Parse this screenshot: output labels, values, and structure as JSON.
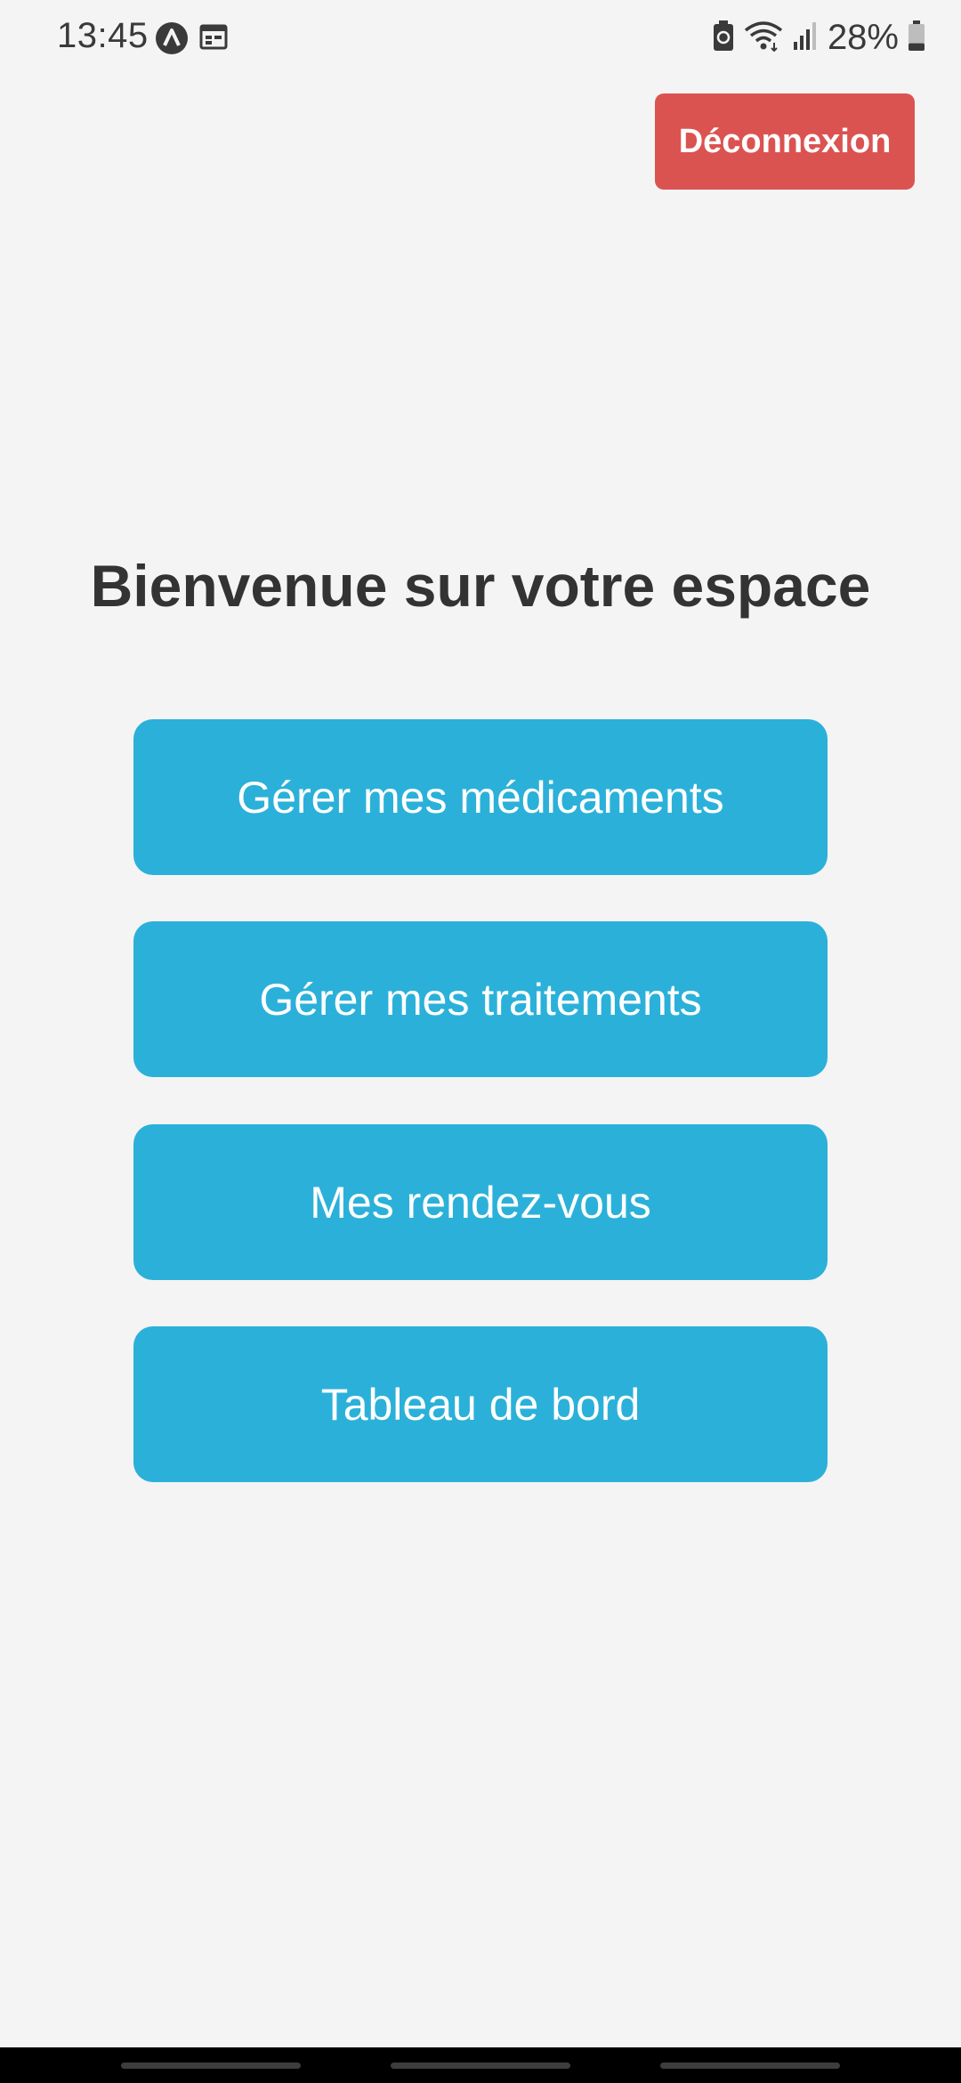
{
  "status_bar": {
    "time": "13:45",
    "battery_percent": "28%",
    "left_icons": [
      "app-notification-icon",
      "calendar-icon"
    ],
    "right_icons": [
      "battery-saver-icon",
      "wifi-icon",
      "signal-icon",
      "battery-icon"
    ],
    "battery_level": 0.28
  },
  "header": {
    "logout_label": "Déconnexion"
  },
  "main": {
    "title": "Bienvenue sur votre espace",
    "buttons": [
      {
        "label": "Gérer mes médicaments"
      },
      {
        "label": "Gérer mes traitements"
      },
      {
        "label": "Mes rendez-vous"
      },
      {
        "label": "Tableau de bord"
      }
    ]
  },
  "colors": {
    "background": "#f4f4f4",
    "primary_button": "#2bb1d9",
    "logout_button": "#db5350",
    "title_text": "#333333"
  }
}
